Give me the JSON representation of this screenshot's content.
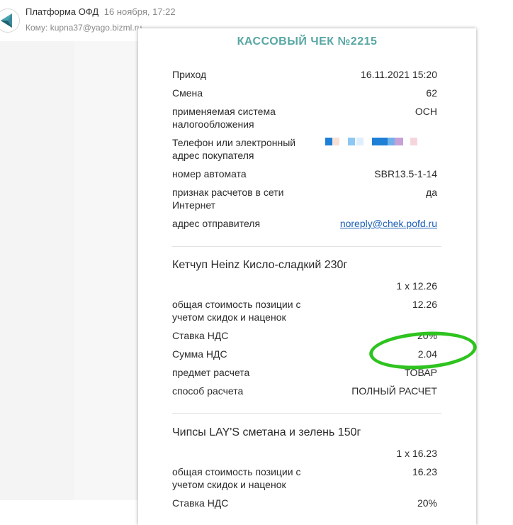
{
  "email": {
    "sender": "Платформа ОФД",
    "date": "16 ноября, 17:22",
    "to_label": "Кому:",
    "to_address": "kupna37@yago.bizml.ru"
  },
  "receipt": {
    "title": "КАССОВЫЙ ЧЕК №2215",
    "fields": [
      {
        "label": "Приход",
        "value": "16.11.2021 15:20"
      },
      {
        "label": "Смена",
        "value": "62"
      },
      {
        "label": "применяемая система налогообложения",
        "value": "ОСН"
      },
      {
        "label": "Телефон или электронный адрес покупателя",
        "value": ""
      },
      {
        "label": "номер автомата",
        "value": "SBR13.5-1-14"
      },
      {
        "label": "признак расчетов в сети Интернет",
        "value": "да"
      },
      {
        "label": "адрес отправителя",
        "value": "noreply@chek.pofd.ru"
      }
    ],
    "items": [
      {
        "name": "Кетчуп Heinz Кисло-сладкий 230г",
        "qty_price": "1 x 12.26",
        "fields": [
          {
            "label": "общая стоимость позиции с учетом скидок и наценок",
            "value": "12.26"
          },
          {
            "label": "Ставка НДС",
            "value": "20%"
          },
          {
            "label": "Сумма НДС",
            "value": "2.04"
          },
          {
            "label": "предмет расчета",
            "value": "ТОВАР"
          },
          {
            "label": "способ расчета",
            "value": "ПОЛНЫЙ РАСЧЕТ"
          }
        ]
      },
      {
        "name": "Чипсы LAY'S сметана и зелень 150г",
        "qty_price": "1 x 16.23",
        "fields": [
          {
            "label": "общая стоимость позиции с учетом скидок и наценок",
            "value": "16.23"
          },
          {
            "label": "Ставка НДС",
            "value": "20%"
          }
        ]
      }
    ]
  },
  "colors": {
    "title": "#58a7a4",
    "link": "#1a5fb4",
    "highlight": "#2ec31f"
  },
  "icons": {
    "avatar": "ofd-logo-icon"
  }
}
